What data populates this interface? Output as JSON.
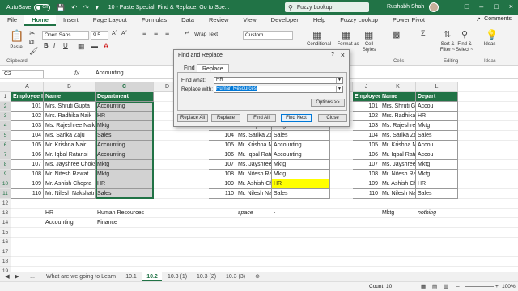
{
  "titlebar": {
    "autosave_label": "AutoSave",
    "autosave_state": "Off",
    "doc_title": "10 - Paste Special, Find & Replace, Go to Spe...",
    "search_text": "Fuzzy Lookup",
    "user_name": "Rushabh Shah"
  },
  "tabs": [
    "File",
    "Home",
    "Insert",
    "Page Layout",
    "Formulas",
    "Data",
    "Review",
    "View",
    "Developer",
    "Help",
    "Fuzzy Lookup",
    "Power Pivot"
  ],
  "comments_label": "Comments",
  "ribbon": {
    "paste_label": "Paste",
    "clipboard_label": "Clipboard",
    "font_name": "Open Sans",
    "font_size": "9.5",
    "wrap_text_label": "Wrap Text",
    "number_format": "Custom",
    "conditional_label": "Conditional",
    "format_as_label": "Format as",
    "cell_label": "Cell",
    "styles_label": "Styles",
    "cells_label": "Cells",
    "sort_label": "Sort &",
    "filter_label": "Filter ~",
    "find_label": "Find &",
    "select_label": "Select ~",
    "ideas_label": "Ideas",
    "editing_label": "Editing",
    "ideas_group_label": "Ideas"
  },
  "formula_bar": {
    "name_box": "C2",
    "fx": "fx",
    "value": "Accounting"
  },
  "columns": [
    "A",
    "B",
    "C",
    "D",
    "E",
    "F",
    "G",
    "H",
    "I",
    "J",
    "K",
    "L"
  ],
  "rows": [
    "1",
    "2",
    "3",
    "4",
    "5",
    "6",
    "7",
    "8",
    "9",
    "10",
    "11",
    "12",
    "13",
    "14",
    "15",
    "16",
    "17",
    "18",
    "19"
  ],
  "table_headers": [
    "Employee ID",
    "Name",
    "Department"
  ],
  "table1": [
    [
      "101",
      "Mrs. Shruti Gupta",
      "Accounting"
    ],
    [
      "102",
      "Mrs. Radhika Naik",
      "HR"
    ],
    [
      "103",
      "Ms. Rajeshree Naik",
      "Mktg"
    ],
    [
      "104",
      "Ms. Sarika Zaju",
      "Sales"
    ],
    [
      "105",
      "Mr. Krishna Nair",
      "Accounting"
    ],
    [
      "106",
      "Mr. Iqbal Ratansi",
      "Accounting"
    ],
    [
      "107",
      "Ms. Jayshree Choksi",
      "Mktg"
    ],
    [
      "108",
      "Mr. Nitesh Rawat",
      "Mktg"
    ],
    [
      "109",
      "Mr. Ashish Chopra",
      "HR"
    ],
    [
      "110",
      "Mr. Nilesh Nakshatra",
      "Sales"
    ]
  ],
  "table2": [
    [
      "101",
      "Mrs. Shruti Gupta",
      ""
    ],
    [
      "102",
      "Mrs. Radhika Naik",
      ""
    ],
    [
      "103",
      "Ms. Rajeshree Naik",
      "Mktg"
    ],
    [
      "104",
      "Ms. Sarika Zaju",
      "Sales"
    ],
    [
      "105",
      "Mr. Krishna Nair",
      "Accounting"
    ],
    [
      "106",
      "Mr. Iqbal Ratansi",
      "Accounting"
    ],
    [
      "107",
      "Ms. Jayshree Choksi",
      "Mktg"
    ],
    [
      "108",
      "Mr. Nitesh Rawat",
      "Mktg"
    ],
    [
      "109",
      "Mr. Ashish Chopra",
      "HR"
    ],
    [
      "110",
      "Mr. Nilesh Nakshatra",
      "Sales"
    ]
  ],
  "table3_headers": [
    "Employee ID",
    "Name",
    "Depart"
  ],
  "table3": [
    [
      "101",
      "Mrs. Shruti Gupta",
      "Accou"
    ],
    [
      "102",
      "Mrs. Radhika Naik",
      "HR"
    ],
    [
      "103",
      "Ms. Rajeshree Naik",
      "Mktg"
    ],
    [
      "104",
      "Ms. Sarika Zaju",
      "Sales"
    ],
    [
      "105",
      "Mr. Krishna Nair",
      "Accou"
    ],
    [
      "106",
      "Mr. Iqbal Ratansi",
      "Accou"
    ],
    [
      "107",
      "Ms. Jayshree Choksi",
      "Mktg"
    ],
    [
      "108",
      "Mr. Nitesh Rawat",
      "Mktg"
    ],
    [
      "109",
      "Mr. Ashish Chopra",
      "HR"
    ],
    [
      "110",
      "Mr. Nilesh Nakshatra",
      "Sales"
    ]
  ],
  "extra_cells": {
    "b13": "HR",
    "c13": "Human Resources",
    "b14": "Accounting",
    "c14": "Finance",
    "g13": "space",
    "h13": "-",
    "l13": "Mktg",
    "m13": "nothing"
  },
  "dialog": {
    "title": "Find and Replace",
    "help": "?",
    "close": "×",
    "tab_find": "Find",
    "tab_replace": "Replace",
    "find_what_label": "Find what:",
    "find_what_value": "HR",
    "replace_with_label": "Replace with:",
    "replace_with_value": "Human Resources",
    "options_button": "Options >>",
    "replace_all_button": "Replace All",
    "replace_button": "Replace",
    "find_all_button": "Find All",
    "find_next_button": "Find Next",
    "close_button": "Close"
  },
  "sheet_tabs": [
    "What are we going to Learn",
    "10.1",
    "10.2",
    "10.3 (1)",
    "10.3 (2)",
    "10.3 (3)"
  ],
  "active_sheet": "10.2",
  "status": {
    "count_label": "Count: 10",
    "zoom": "100%"
  },
  "colors": {
    "excel_green": "#217346",
    "header_fill": "#217346",
    "highlight": "#ffff00"
  }
}
